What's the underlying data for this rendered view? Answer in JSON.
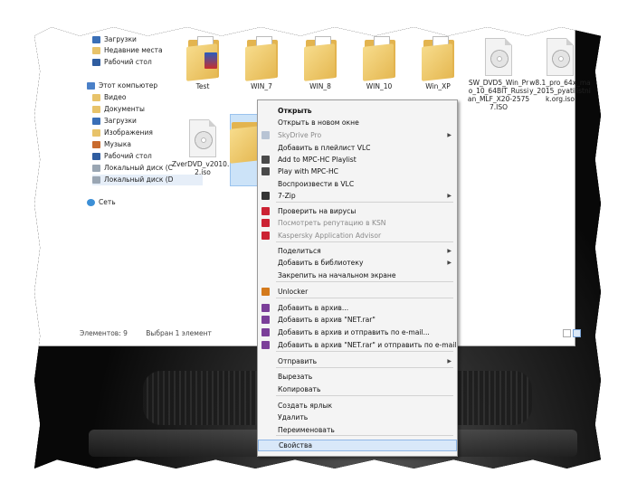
{
  "nav": {
    "items": [
      {
        "label": "Загрузки",
        "icon": "downloads-icon"
      },
      {
        "label": "Недавние места",
        "icon": "recent-places-icon"
      },
      {
        "label": "Рабочий стол",
        "icon": "desktop-icon"
      },
      {
        "label": "Этот компьютер",
        "icon": "computer-icon"
      },
      {
        "label": "Видео",
        "icon": "video-folder-icon"
      },
      {
        "label": "Документы",
        "icon": "documents-folder-icon"
      },
      {
        "label": "Загрузки",
        "icon": "downloads-folder-icon"
      },
      {
        "label": "Изображения",
        "icon": "pictures-folder-icon"
      },
      {
        "label": "Музыка",
        "icon": "music-folder-icon"
      },
      {
        "label": "Рабочий стол",
        "icon": "desktop-folder-icon"
      },
      {
        "label": "Локальный диск (C",
        "icon": "drive-c-icon"
      },
      {
        "label": "Локальный диск (D",
        "icon": "drive-d-icon"
      },
      {
        "label": "Сеть",
        "icon": "network-icon"
      }
    ]
  },
  "files": [
    {
      "label": "Test",
      "type": "folder"
    },
    {
      "label": "WIN_7",
      "type": "folder"
    },
    {
      "label": "WIN_8",
      "type": "folder"
    },
    {
      "label": "WIN_10",
      "type": "folder"
    },
    {
      "label": "Win_XP",
      "type": "folder"
    },
    {
      "label": "SW_DVD5_Win_Pro_10_64BIT_Russian_MLF_X20-25757.ISO",
      "type": "iso"
    },
    {
      "label": "w8.1_pro_64x_may_2015_pyatilistnik.org.iso",
      "type": "iso"
    },
    {
      "label": "ZverDVD_v2010.12.iso",
      "type": "iso"
    }
  ],
  "status": {
    "count": "Элементов: 9",
    "selected": "Выбран 1 элемент"
  },
  "menu": {
    "items": [
      {
        "label": "Открыть",
        "bold": true
      },
      {
        "label": "Открыть в новом окне"
      },
      {
        "label": "SkyDrive Pro",
        "disabled": true,
        "submenu": true,
        "icon": "skydrive-icon"
      },
      {
        "label": "Добавить в плейлист VLC"
      },
      {
        "label": "Add to MPC-HC Playlist",
        "icon": "mpc-hc-icon"
      },
      {
        "label": "Play with MPC-HC",
        "icon": "mpc-hc-icon"
      },
      {
        "label": "Воспроизвести в VLC"
      },
      {
        "label": "7-Zip",
        "submenu": true,
        "icon": "7zip-icon"
      },
      {
        "label": "Проверить на вирусы",
        "icon": "kaspersky-icon"
      },
      {
        "label": "Посмотреть репутацию в KSN",
        "disabled": true,
        "icon": "kaspersky-icon"
      },
      {
        "label": "Kaspersky Application Advisor",
        "disabled": true,
        "icon": "kaspersky-icon"
      },
      {
        "label": "Поделиться",
        "submenu": true
      },
      {
        "label": "Добавить в библиотеку",
        "submenu": true
      },
      {
        "label": "Закрепить на начальном экране"
      },
      {
        "label": "Unlocker",
        "icon": "unlocker-icon"
      },
      {
        "label": "Добавить в архив...",
        "icon": "winrar-icon"
      },
      {
        "label": "Добавить в архив \"NET.rar\"",
        "icon": "winrar-icon"
      },
      {
        "label": "Добавить в архив и отправить по e-mail...",
        "icon": "winrar-icon"
      },
      {
        "label": "Добавить в архив \"NET.rar\" и отправить по e-mail",
        "icon": "winrar-icon"
      },
      {
        "label": "Отправить",
        "submenu": true
      },
      {
        "label": "Вырезать"
      },
      {
        "label": "Копировать"
      },
      {
        "label": "Создать ярлык"
      },
      {
        "label": "Удалить"
      },
      {
        "label": "Переименовать"
      },
      {
        "label": "Свойства",
        "highlighted": true
      }
    ]
  },
  "colors": {
    "accent": "#d9e8f9",
    "menu_bg": "#f4f4f4",
    "folder": "#e8c36a"
  }
}
